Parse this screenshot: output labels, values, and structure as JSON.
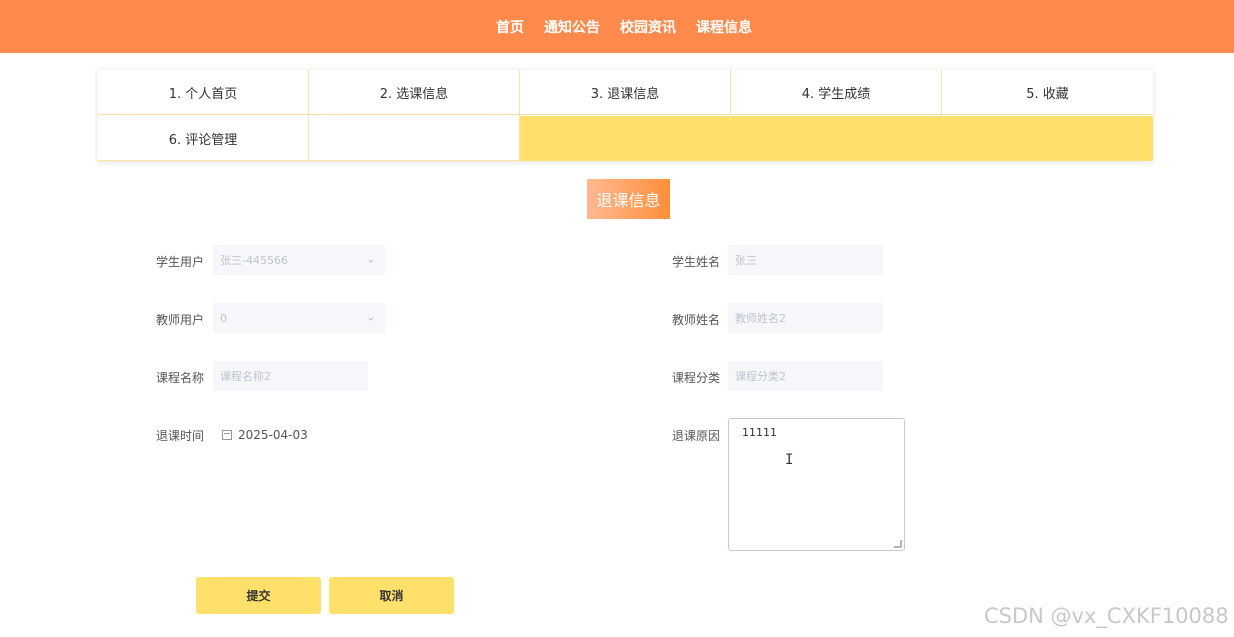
{
  "header": {
    "nav": [
      "首页",
      "通知公告",
      "校园资讯",
      "课程信息"
    ]
  },
  "tabs": [
    "1. 个人首页",
    "2. 选课信息",
    "3. 退课信息",
    "4. 学生成绩",
    "5. 收藏",
    "6. 评论管理"
  ],
  "page_title": "退课信息",
  "form": {
    "student_user_label": "学生用户",
    "student_user_value": "张三-445566",
    "student_name_label": "学生姓名",
    "student_name_value": "张三",
    "teacher_user_label": "教师用户",
    "teacher_user_value": "0",
    "teacher_name_label": "教师姓名",
    "teacher_name_value": "教师姓名2",
    "course_name_label": "课程名称",
    "course_name_value": "课程名称2",
    "course_category_label": "课程分类",
    "course_category_value": "课程分类2",
    "withdraw_time_label": "退课时间",
    "withdraw_time_value": "2025-04-03",
    "withdraw_reason_label": "退课原因",
    "withdraw_reason_value": "11111"
  },
  "buttons": {
    "submit": "提交",
    "cancel": "取消"
  },
  "watermark": "CSDN @vx_CXKF10088",
  "colors": {
    "header": "#ff8a4c",
    "accent_yellow": "#ffe06b",
    "title_gradient_start": "#ffb891",
    "title_gradient_end": "#ff8f3a"
  }
}
